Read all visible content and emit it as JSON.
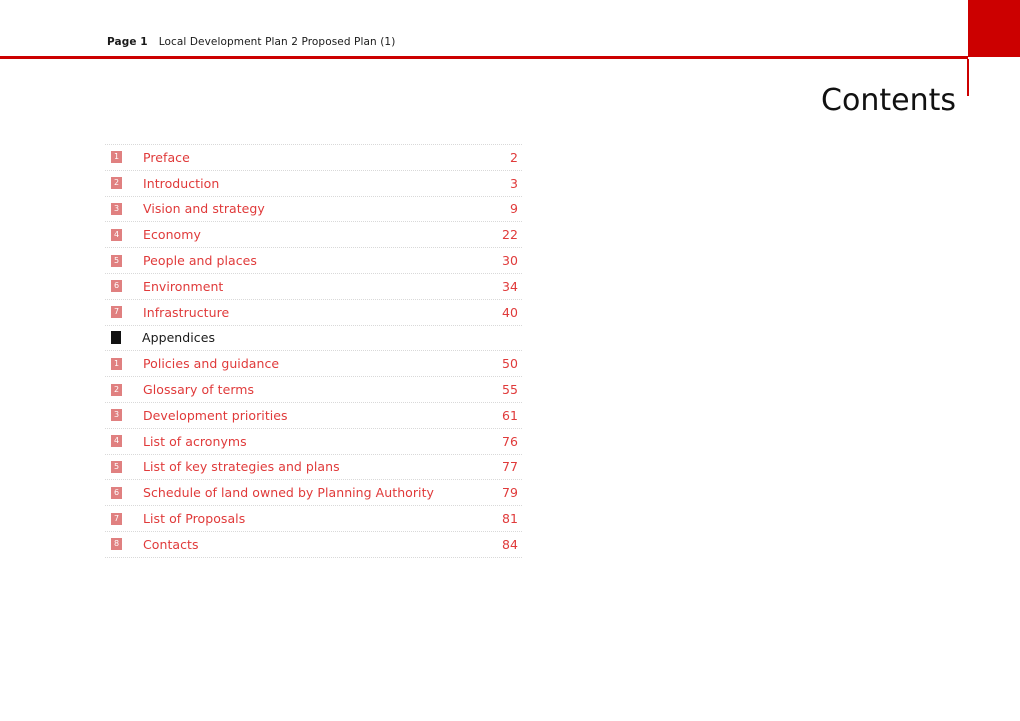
{
  "header": {
    "page_label": "Page 1",
    "document_title": "Local Development Plan 2 Proposed Plan (1)",
    "accent_color": "#cc0000"
  },
  "title": "Contents",
  "contents": {
    "rows": [
      {
        "badge": "1",
        "label": "Preface",
        "page": "2",
        "type": "chapter"
      },
      {
        "badge": "2",
        "label": "Introduction",
        "page": "3",
        "type": "chapter"
      },
      {
        "badge": "3",
        "label": "Vision and strategy",
        "page": "9",
        "type": "chapter"
      },
      {
        "badge": "4",
        "label": "Economy",
        "page": "22",
        "type": "chapter"
      },
      {
        "badge": "5",
        "label": "People and places",
        "page": "30",
        "type": "chapter"
      },
      {
        "badge": "6",
        "label": "Environment",
        "page": "34",
        "type": "chapter"
      },
      {
        "badge": "7",
        "label": "Infrastructure",
        "page": "40",
        "type": "chapter"
      },
      {
        "badge": "",
        "label": "Appendices",
        "page": "",
        "type": "section"
      },
      {
        "badge": "1",
        "label": "Policies and guidance",
        "page": "50",
        "type": "chapter"
      },
      {
        "badge": "2",
        "label": "Glossary of terms",
        "page": "55",
        "type": "chapter"
      },
      {
        "badge": "3",
        "label": "Development priorities",
        "page": "61",
        "type": "chapter"
      },
      {
        "badge": "4",
        "label": "List of acronyms",
        "page": "76",
        "type": "chapter"
      },
      {
        "badge": "5",
        "label": "List of key strategies and plans",
        "page": "77",
        "type": "chapter"
      },
      {
        "badge": "6",
        "label": "Schedule of land owned by Planning Authority",
        "page": "79",
        "type": "chapter"
      },
      {
        "badge": "7",
        "label": "List of Proposals",
        "page": "81",
        "type": "chapter"
      },
      {
        "badge": "8",
        "label": "Contacts",
        "page": "84",
        "type": "chapter"
      }
    ]
  },
  "colors": {
    "accent_red": "#cc0000",
    "link_red": "#e03a3a",
    "badge_pink": "#e08080",
    "rule_grey": "#d9d9d9",
    "text_black": "#1a1a1a"
  }
}
